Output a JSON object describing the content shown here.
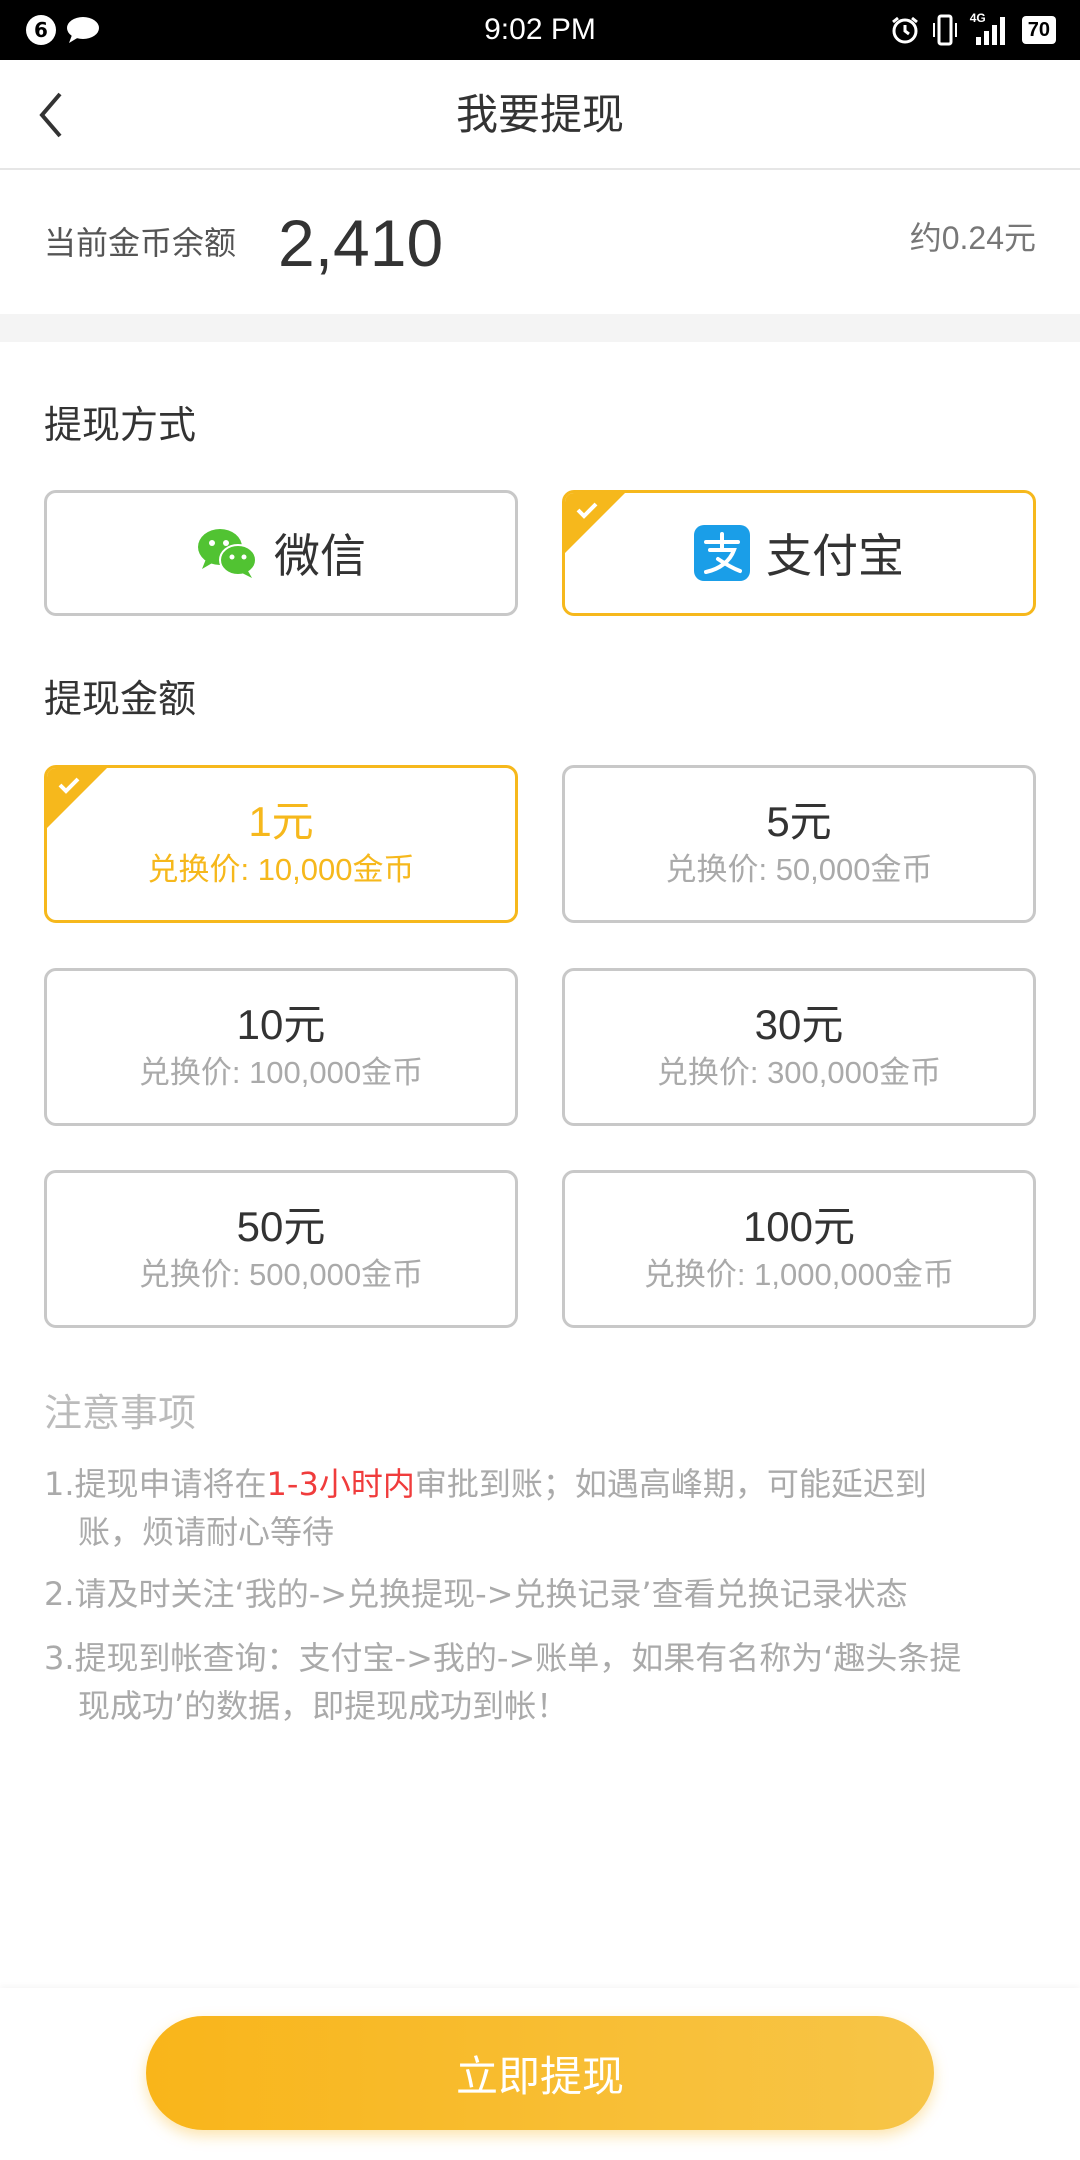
{
  "status_bar": {
    "notification_count": "6",
    "time": "9:02 PM",
    "network": "4G",
    "battery": "70"
  },
  "header": {
    "title": "我要提现"
  },
  "balance": {
    "label": "当前金币余额",
    "value": "2,410",
    "approx": "约0.24元"
  },
  "methods": {
    "title": "提现方式",
    "items": [
      {
        "label": "微信",
        "icon": "wechat-icon",
        "selected": false
      },
      {
        "label": "支付宝",
        "icon": "alipay-icon",
        "selected": true
      }
    ]
  },
  "amounts": {
    "title": "提现金额",
    "items": [
      {
        "value": "1元",
        "price": "兑换价: 10,000金币",
        "selected": true
      },
      {
        "value": "5元",
        "price": "兑换价: 50,000金币",
        "selected": false
      },
      {
        "value": "10元",
        "price": "兑换价: 100,000金币",
        "selected": false
      },
      {
        "value": "30元",
        "price": "兑换价: 300,000金币",
        "selected": false
      },
      {
        "value": "50元",
        "price": "兑换价: 500,000金币",
        "selected": false
      },
      {
        "value": "100元",
        "price": "兑换价: 1,000,000金币",
        "selected": false
      }
    ]
  },
  "notes": {
    "title": "注意事项",
    "note1": {
      "prefix": "1.提现申请将在",
      "highlight": "1-3小时内",
      "suffix_line1": "审批到账；如遇高峰期，可能延迟到",
      "line2": "账，烦请耐心等待"
    },
    "note2": "2.请及时关注‘我的->兑换提现->兑换记录’查看兑换记录状态",
    "note3": {
      "line1": "3.提现到帐查询：支付宝->我的->账单，如果有名称为‘趣头条提",
      "line2": "现成功’的数据，即提现成功到帐！"
    }
  },
  "submit_label": "立即提现",
  "colors": {
    "accent": "#f6b81c",
    "highlight": "#f03c3c",
    "wechat": "#51c332",
    "alipay": "#1a9ee8"
  }
}
